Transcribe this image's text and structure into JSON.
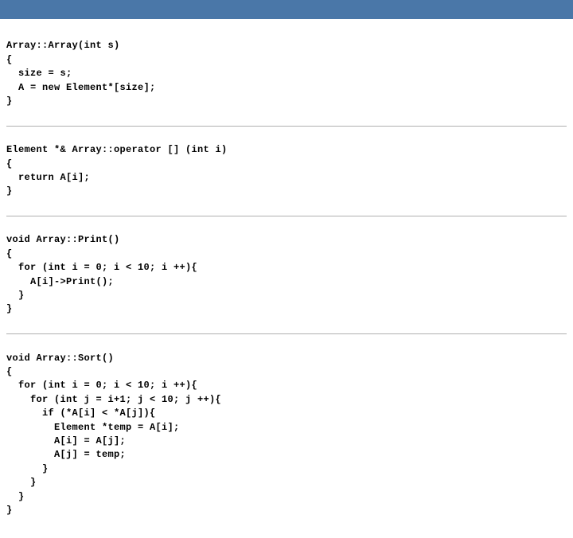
{
  "blocks": {
    "b1": "Array::Array(int s)\n{\n  size = s;\n  A = new Element*[size];\n}",
    "b2": "Element *& Array::operator [] (int i)\n{\n  return A[i];\n}",
    "b3": "void Array::Print()\n{\n  for (int i = 0; i < 10; i ++){\n    A[i]->Print();\n  }\n}",
    "b4": "void Array::Sort()\n{\n  for (int i = 0; i < 10; i ++){\n    for (int j = i+1; j < 10; j ++){\n      if (*A[i] < *A[j]){\n        Element *temp = A[i];\n        A[i] = A[j];\n        A[j] = temp;\n      }\n    }\n  }\n}"
  }
}
